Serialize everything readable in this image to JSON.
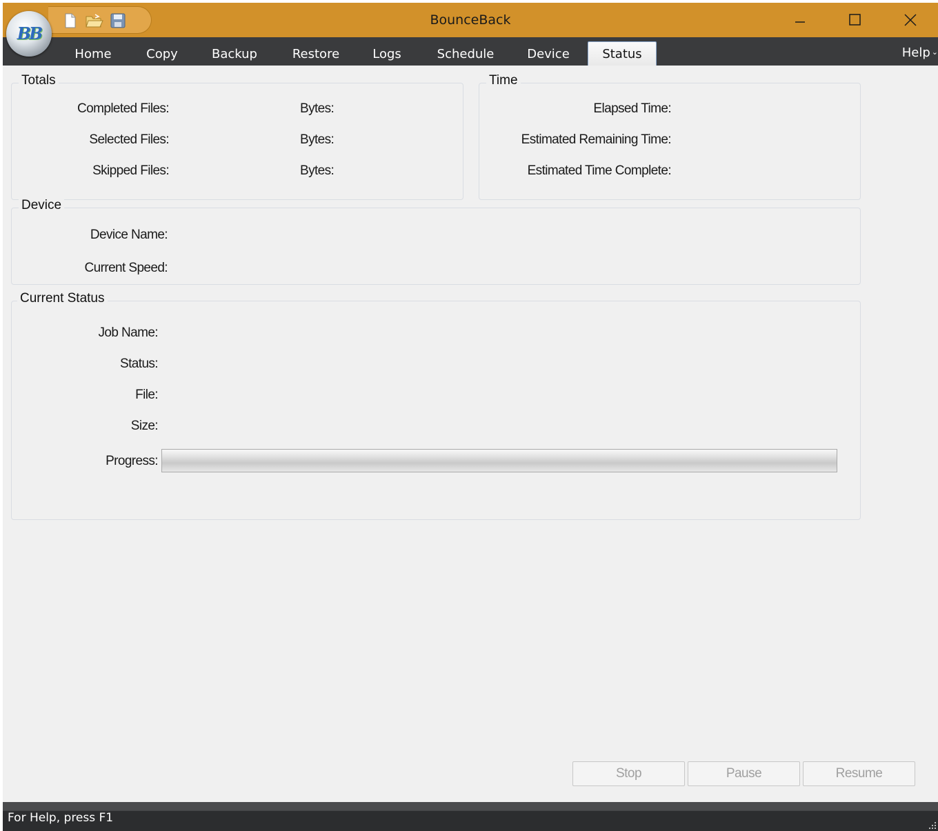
{
  "window": {
    "title": "BounceBack",
    "orb_logo_text": "BB"
  },
  "quick_access": {
    "icons": [
      "new-document-icon",
      "open-folder-icon",
      "save-disk-icon"
    ]
  },
  "window_controls": [
    "minimize-icon",
    "maximize-icon",
    "close-icon"
  ],
  "tabs": [
    {
      "label": "Home"
    },
    {
      "label": "Copy"
    },
    {
      "label": "Backup"
    },
    {
      "label": "Restore"
    },
    {
      "label": "Logs"
    },
    {
      "label": "Schedule"
    },
    {
      "label": "Device"
    },
    {
      "label": "Status",
      "active": true
    }
  ],
  "help_menu": {
    "label": "Help",
    "icon": "chevron-down-icon"
  },
  "totals": {
    "title": "Totals",
    "completed_files_label": "Completed Files:",
    "selected_files_label": "Selected Files:",
    "skipped_files_label": "Skipped Files:",
    "bytes_label": "Bytes:"
  },
  "time": {
    "title": "Time",
    "elapsed_label": "Elapsed Time:",
    "remaining_label": "Estimated Remaining Time:",
    "complete_label": "Estimated Time Complete:"
  },
  "device": {
    "title": "Device",
    "name_label": "Device Name:",
    "speed_label": "Current Speed:"
  },
  "current_status": {
    "title": "Current Status",
    "job_name_label": "Job Name:",
    "status_label": "Status:",
    "file_label": "File:",
    "size_label": "Size:",
    "progress_label": "Progress:",
    "progress_percent": 0
  },
  "buttons": {
    "stop": "Stop",
    "pause": "Pause",
    "resume": "Resume"
  },
  "statusbar": {
    "text": "For Help, press F1"
  },
  "colors": {
    "titlebar": "#d2912a",
    "tabbar": "#3a3b3d",
    "content_bg": "#f0f0f0",
    "statusbar": "#2c2d2f"
  }
}
